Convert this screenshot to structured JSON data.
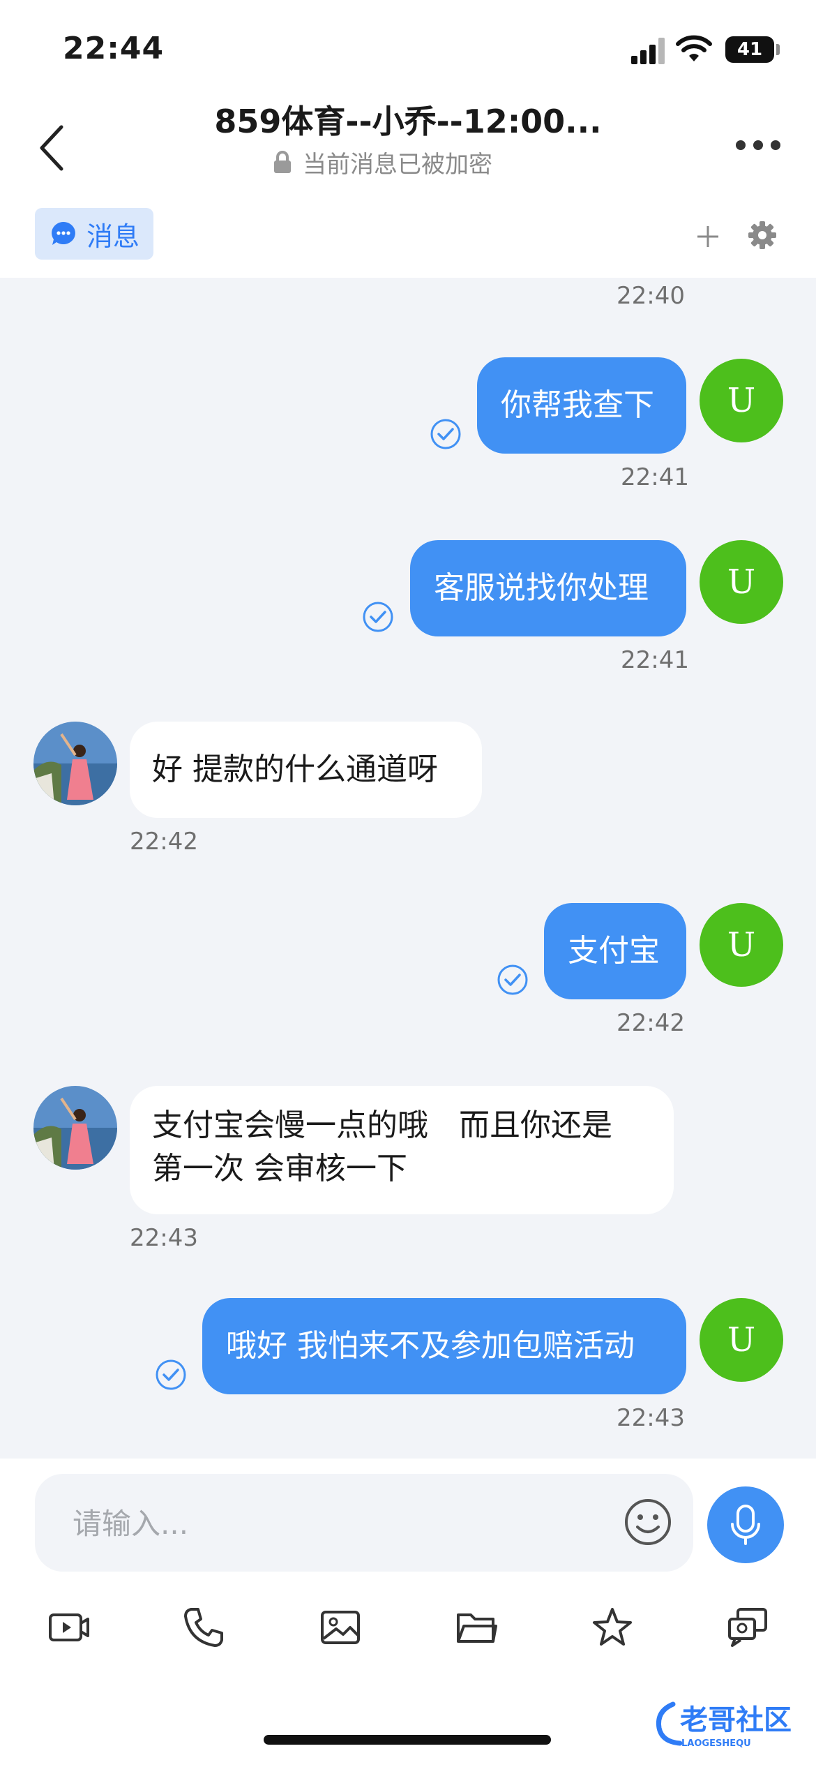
{
  "status_bar": {
    "time": "22:44",
    "battery": "41"
  },
  "header": {
    "title": "859体育--小乔--12:00...",
    "encryption_notice": "当前消息已被加密"
  },
  "tabs": {
    "messages_label": "消息"
  },
  "avatar_letter": "U",
  "messages": [
    {
      "type": "timestamp",
      "text": "22:40"
    },
    {
      "direction": "out",
      "text": "你帮我查下",
      "time": "22:41",
      "read": true
    },
    {
      "direction": "out",
      "text": "客服说找你处理",
      "time": "22:41",
      "read": true
    },
    {
      "direction": "in",
      "text": "好 提款的什么通道呀",
      "time": "22:42"
    },
    {
      "direction": "out",
      "text": "支付宝",
      "time": "22:42",
      "read": true
    },
    {
      "direction": "in",
      "line1": "支付宝会慢一点的哦　而且你还是",
      "line2": "第一次 会审核一下",
      "time": "22:43"
    },
    {
      "direction": "out",
      "text": "哦好 我怕来不及参加包赔活动",
      "time": "22:43",
      "read": true
    }
  ],
  "input": {
    "placeholder": "请输入..."
  },
  "watermark": {
    "text": "老哥社区",
    "subtext": "LAOGESHEQU"
  },
  "colors": {
    "accent": "#4191f4",
    "avatar_green": "#4dbf1c",
    "chat_background": "#f2f4f8",
    "tab_highlight": "#dbe8fb"
  },
  "icons": [
    "back-icon",
    "lock-icon",
    "more-icon",
    "message-bubble-icon",
    "plus-icon",
    "gear-icon",
    "read-check-icon",
    "emoji-icon",
    "microphone-icon",
    "video-icon",
    "phone-icon",
    "image-icon",
    "folder-icon",
    "star-icon",
    "screen-share-icon"
  ]
}
